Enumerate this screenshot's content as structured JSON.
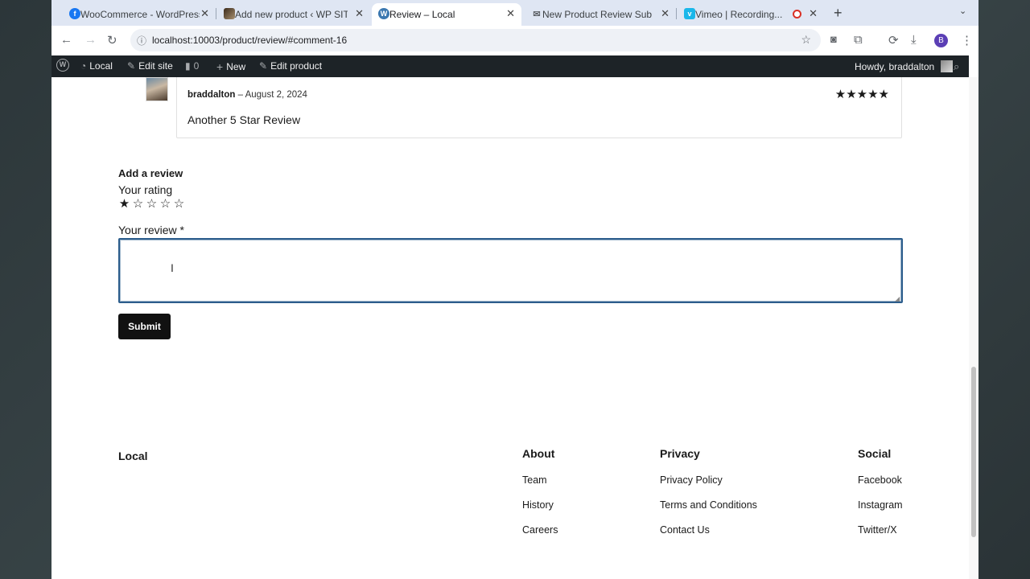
{
  "browser": {
    "tabs": [
      {
        "title": "WooCommerce - WordPress",
        "favicon": "facebook-icon",
        "color": "#1877f2",
        "glyph": "f"
      },
      {
        "title": "Add new product ‹ WP SITES",
        "favicon": "photo-icon",
        "color": "#5a4a3a",
        "glyph": ""
      },
      {
        "title": "Review – Local",
        "favicon": "wordpress-icon",
        "color": "#3c78b0",
        "glyph": "W"
      },
      {
        "title": "New Product Review Submitt",
        "favicon": "mail-icon",
        "color": "#7a8a7a",
        "glyph": "✉"
      },
      {
        "title": "Vimeo | Recording...",
        "favicon": "vimeo-icon",
        "color": "#1ab7ea",
        "glyph": "v"
      }
    ],
    "url": "localhost:10003/product/review/#comment-16",
    "profile_initial": "B"
  },
  "adminbar": {
    "site": "Local",
    "edit_site": "Edit site",
    "comments_count": "0",
    "new": "New",
    "edit_product": "Edit product",
    "howdy": "Howdy, braddalton"
  },
  "comment": {
    "author": "braddalton",
    "date": "– August 2, 2024",
    "stars": "★★★★★",
    "text": "Another 5 Star Review"
  },
  "review_form": {
    "heading": "Add a review",
    "rating_label": "Your rating",
    "rating_selected": 1,
    "rating_max": 5,
    "review_label": "Your review *",
    "review_value": "",
    "submit_label": "Submit"
  },
  "footer": {
    "brand": "Local",
    "about": {
      "heading": "About",
      "links": [
        "Team",
        "History",
        "Careers"
      ]
    },
    "privacy": {
      "heading": "Privacy",
      "links": [
        "Privacy Policy",
        "Terms and Conditions",
        "Contact Us"
      ]
    },
    "social": {
      "heading": "Social",
      "links": [
        "Facebook",
        "Instagram",
        "Twitter/X"
      ]
    }
  }
}
